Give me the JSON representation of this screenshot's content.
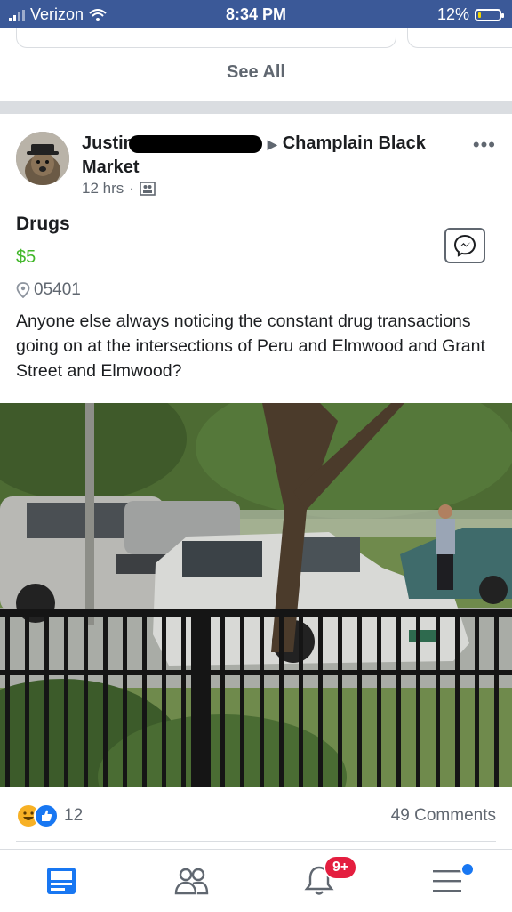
{
  "status_bar": {
    "carrier": "Verizon",
    "time": "8:34 PM",
    "battery_percent": "12%",
    "battery_level": 0.12
  },
  "feed": {
    "see_all_label": "See All"
  },
  "post": {
    "author_name": "Justin",
    "group_name": "Champlain Black Market",
    "time_ago": "12 hrs",
    "more_label": "•••",
    "listing": {
      "title": "Drugs",
      "price": "$5",
      "zip": "05401",
      "description": "Anyone else always noticing the constant drug transactions going on at the intersections of Peru and Elmwood and Grant Street and Elmwood?"
    },
    "reaction_count": "12",
    "comments_label": "49 Comments"
  },
  "tab_bar": {
    "notifications_badge": "9+"
  },
  "colors": {
    "header_blue": "#3b5998",
    "price_green": "#42b72a",
    "badge_red": "#e41e3f",
    "accent_blue": "#1877f2"
  },
  "icons": [
    "wifi-icon",
    "signal-icon",
    "battery-icon",
    "globe-icon",
    "location-pin-icon",
    "messenger-icon",
    "haha-reaction-icon",
    "like-reaction-icon",
    "news-feed-icon",
    "friends-icon",
    "notifications-bell-icon",
    "menu-icon"
  ]
}
